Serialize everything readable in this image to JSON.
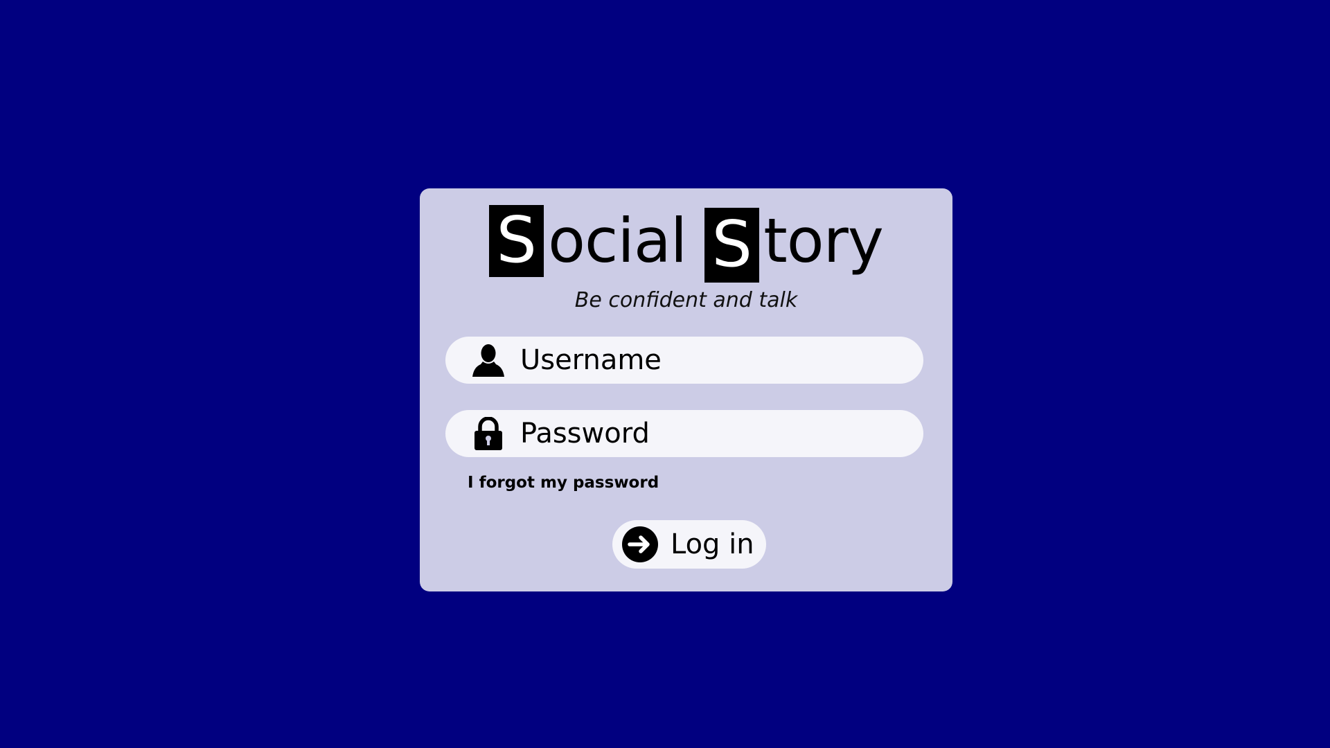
{
  "app": {
    "logo": {
      "word1_initial": "S",
      "word1_rest": "ocial",
      "word2_initial": "S",
      "word2_rest": "tory"
    },
    "tagline": "Be confident and talk"
  },
  "login_form": {
    "username": {
      "placeholder": "Username",
      "value": "",
      "icon": "user-icon"
    },
    "password": {
      "placeholder": "Password",
      "value": "",
      "icon": "lock-icon"
    },
    "forgot_link": "I forgot my password",
    "login_button": {
      "label": "Log in",
      "icon": "arrow-right-circle-icon"
    }
  },
  "colors": {
    "background": "#010080",
    "card": "#cccce6",
    "field": "#f5f5fa",
    "text": "#000000"
  }
}
